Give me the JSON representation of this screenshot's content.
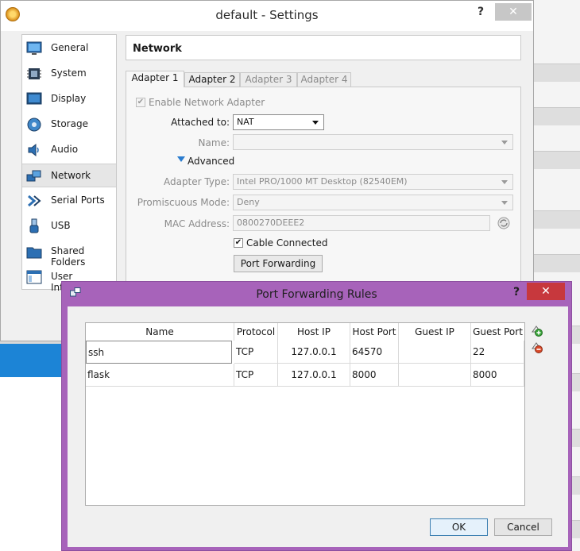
{
  "settings_window": {
    "title": "default - Settings",
    "help": "?",
    "close": "✕",
    "section_title": "Network",
    "sidebar": [
      {
        "label": "General",
        "icon": "monitor-icon"
      },
      {
        "label": "System",
        "icon": "chip-icon"
      },
      {
        "label": "Display",
        "icon": "display-icon"
      },
      {
        "label": "Storage",
        "icon": "storage-icon"
      },
      {
        "label": "Audio",
        "icon": "speaker-icon"
      },
      {
        "label": "Network",
        "icon": "network-icon",
        "active": true
      },
      {
        "label": "Serial Ports",
        "icon": "serial-port-icon"
      },
      {
        "label": "USB",
        "icon": "usb-icon"
      },
      {
        "label": "Shared Folders",
        "icon": "folder-icon"
      },
      {
        "label": "User Interface",
        "icon": "window-icon"
      }
    ],
    "tabs": [
      "Adapter 1",
      "Adapter 2",
      "Adapter 3",
      "Adapter 4"
    ],
    "adapter": {
      "enable_label": "Enable Network Adapter",
      "attached_label": "Attached to:",
      "attached_value": "NAT",
      "name_label": "Name:",
      "name_value": "",
      "advanced_label": "Advanced",
      "adapter_type_label": "Adapter Type:",
      "adapter_type_value": "Intel PRO/1000 MT Desktop (82540EM)",
      "promiscuous_label": "Promiscuous Mode:",
      "promiscuous_value": "Deny",
      "mac_label": "MAC Address:",
      "mac_value": "0800270DEEE2",
      "cable_label": "Cable Connected",
      "port_forwarding_label": "Port Forwarding"
    }
  },
  "port_forwarding_dialog": {
    "title": "Port Forwarding Rules",
    "help": "?",
    "close": "✕",
    "columns": [
      "Name",
      "Protocol",
      "Host IP",
      "Host Port",
      "Guest IP",
      "Guest Port"
    ],
    "rows": [
      [
        "ssh",
        "TCP",
        "127.0.0.1",
        "64570",
        "",
        "22"
      ],
      [
        "flask",
        "TCP",
        "127.0.0.1",
        "8000",
        "",
        "8000"
      ]
    ],
    "ok_label": "OK",
    "cancel_label": "Cancel"
  },
  "colors": {
    "dialog_frame": "#a763ba",
    "close_red": "#c7383d",
    "accent_blue": "#1c84d6"
  }
}
